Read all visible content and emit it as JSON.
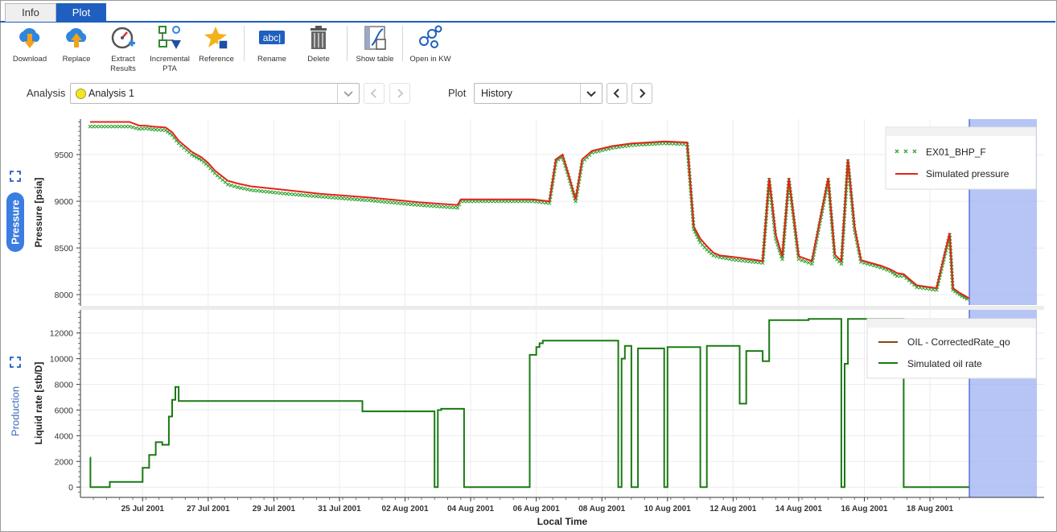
{
  "tabs": [
    {
      "label": "Info"
    },
    {
      "label": "Plot"
    }
  ],
  "toolbar": {
    "download": "Download",
    "replace": "Replace",
    "extract": "Extract Results",
    "incremental": "Incremental PTA",
    "reference": "Reference",
    "rename": "Rename",
    "rename_icon_text": "abc|",
    "delete": "Delete",
    "show_table": "Show table",
    "open_kw": "Open in KW"
  },
  "selectors": {
    "analysis_label": "Analysis",
    "analysis_value": "Analysis 1",
    "plot_label": "Plot",
    "plot_value": "History"
  },
  "side_tabs": {
    "pressure": "Pressure",
    "production": "Production"
  },
  "colors": {
    "accent": "#1f5fbf",
    "pressure_tab": "#3b7de0",
    "measured_green": "#2ea12e",
    "simulated_red": "#e32418",
    "rate_green": "#1a7a12",
    "oil_brown": "#8b4513",
    "highlight": "#9db2f2"
  },
  "chart_data": [
    {
      "type": "line",
      "name": "pressure",
      "ylabel": "Pressure [psia]",
      "yticks": [
        8000,
        8500,
        9000,
        9500
      ],
      "ylim": [
        7880,
        9880
      ],
      "xlim": [
        0,
        26.8
      ],
      "legend_position": "top-right",
      "series": [
        {
          "name": "EX01_BHP_F",
          "style": "x-markers",
          "x": [
            0,
            1.2,
            1.5,
            1.7,
            1.9,
            2.3,
            2.5,
            2.7,
            3.1,
            3.4,
            3.6,
            3.8,
            4.2,
            4.5,
            4.9,
            6.0,
            7.0,
            8.5,
            10.0,
            11.2,
            11.3,
            12.5,
            13.5,
            14.0,
            14.2,
            14.4,
            14.6,
            14.8,
            15.0,
            15.3,
            15.9,
            16.5,
            17.5,
            18.2,
            18.4,
            18.6,
            18.8,
            19.0,
            19.2,
            19.7,
            20.5,
            20.7,
            20.9,
            21.1,
            21.3,
            21.6,
            22.0,
            22.5,
            22.7,
            22.9,
            23.1,
            23.3,
            23.5,
            24.1,
            24.4,
            24.6,
            24.8,
            25.2,
            25.8,
            26.2,
            26.3,
            26.5,
            26.8
          ],
          "y": [
            9800,
            9800,
            9775,
            9780,
            9770,
            9760,
            9710,
            9620,
            9500,
            9440,
            9380,
            9300,
            9180,
            9150,
            9120,
            9080,
            9050,
            9010,
            8960,
            8930,
            9000,
            9000,
            9000,
            8980,
            9430,
            9480,
            9250,
            9000,
            9420,
            9520,
            9570,
            9600,
            9620,
            9610,
            8700,
            8560,
            8480,
            8420,
            8400,
            8370,
            8340,
            9230,
            8600,
            8380,
            9230,
            8380,
            8330,
            9230,
            8400,
            8330,
            9430,
            8700,
            8350,
            8290,
            8250,
            8200,
            8200,
            8080,
            8050,
            8640,
            8050,
            8000,
            7940
          ]
        },
        {
          "name": "Simulated pressure",
          "style": "line",
          "x": [
            0,
            1.2,
            1.5,
            1.7,
            1.9,
            2.3,
            2.5,
            2.7,
            3.1,
            3.4,
            3.6,
            3.8,
            4.2,
            4.5,
            4.9,
            6.0,
            7.0,
            8.5,
            10.0,
            11.2,
            11.3,
            12.5,
            13.5,
            14.0,
            14.2,
            14.4,
            14.6,
            14.8,
            15.0,
            15.3,
            15.9,
            16.5,
            17.5,
            18.2,
            18.4,
            18.6,
            18.8,
            19.0,
            19.2,
            19.7,
            20.5,
            20.7,
            20.9,
            21.1,
            21.3,
            21.6,
            22.0,
            22.5,
            22.7,
            22.9,
            23.1,
            23.3,
            23.5,
            24.1,
            24.4,
            24.6,
            24.8,
            25.2,
            25.8,
            26.2,
            26.3,
            26.5,
            26.8
          ],
          "y": [
            9850,
            9850,
            9810,
            9810,
            9800,
            9790,
            9740,
            9650,
            9530,
            9470,
            9410,
            9330,
            9220,
            9190,
            9160,
            9120,
            9080,
            9040,
            8990,
            8960,
            9020,
            9020,
            9020,
            9000,
            9450,
            9500,
            9270,
            9020,
            9450,
            9540,
            9590,
            9620,
            9640,
            9630,
            8730,
            8600,
            8520,
            8450,
            8420,
            8400,
            8360,
            9250,
            8640,
            8410,
            9250,
            8410,
            8360,
            9250,
            8430,
            8360,
            9450,
            8730,
            8370,
            8310,
            8270,
            8230,
            8220,
            8100,
            8070,
            8660,
            8070,
            8020,
            7960
          ]
        }
      ]
    },
    {
      "type": "line",
      "name": "production",
      "ylabel": "Liquid rate [stb/D]",
      "xlabel": "Local Time",
      "yticks": [
        0,
        2000,
        4000,
        6000,
        8000,
        10000,
        12000
      ],
      "ylim": [
        -800,
        13800
      ],
      "xlim": [
        0,
        26.8
      ],
      "xtick_labels": [
        "25 Jul 2001",
        "27 Jul 2001",
        "29 Jul 2001",
        "31 Jul 2001",
        "02 Aug 2001",
        "04 Aug 2001",
        "06 Aug 2001",
        "08 Aug 2001",
        "10 Aug 2001",
        "12 Aug 2001",
        "14 Aug 2001",
        "16 Aug 2001",
        "18 Aug 2001"
      ],
      "xtick_values": [
        1.6,
        3.6,
        5.6,
        7.6,
        9.6,
        11.6,
        13.6,
        15.6,
        17.6,
        19.6,
        21.6,
        23.6,
        25.6
      ],
      "legend_position": "top-right",
      "series": [
        {
          "name": "OIL - CorrectedRate_qo",
          "style": "line",
          "x": [],
          "y": []
        },
        {
          "name": "Simulated oil rate",
          "style": "step",
          "x": [
            0,
            0.01,
            0.6,
            1.4,
            1.6,
            1.8,
            2.0,
            2.2,
            2.4,
            2.5,
            2.6,
            2.7,
            8.3,
            10.4,
            10.5,
            10.6,
            10.7,
            11.0,
            11.4,
            13.3,
            13.4,
            13.6,
            13.7,
            13.8,
            14.0,
            14.3,
            16.1,
            16.2,
            16.3,
            16.5,
            16.7,
            17.0,
            17.3,
            17.5,
            17.6,
            18.1,
            18.4,
            18.6,
            18.8,
            19.3,
            19.8,
            19.9,
            20.0,
            20.1,
            20.3,
            20.5,
            20.7,
            21.9,
            22.0,
            22.1,
            22.4,
            22.9,
            23.0,
            23.1,
            24.8,
            24.9,
            25.0,
            26.8
          ],
          "y": [
            2300,
            0,
            400,
            400,
            1500,
            2500,
            3500,
            3300,
            5500,
            6800,
            7800,
            6700,
            5900,
            5900,
            0,
            6000,
            6100,
            6100,
            0,
            0,
            10300,
            10900,
            11200,
            11400,
            11400,
            11400,
            0,
            10000,
            11000,
            0,
            10800,
            10800,
            10800,
            0,
            10900,
            10900,
            10900,
            0,
            11000,
            11000,
            6500,
            6500,
            10600,
            10600,
            10600,
            9800,
            13000,
            13100,
            13100,
            13100,
            13100,
            0,
            9600,
            13100,
            0,
            0,
            0,
            0
          ]
        }
      ]
    }
  ]
}
